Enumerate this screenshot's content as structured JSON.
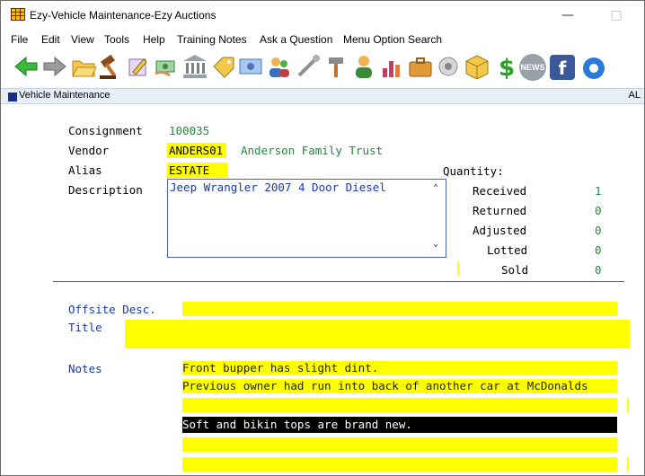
{
  "window": {
    "title": "Ezy-Vehicle Maintenance-Ezy Auctions",
    "minimize": "—",
    "maximize": "□"
  },
  "menu": [
    "File",
    "Edit",
    "View",
    "Tools",
    "Help",
    "Training Notes",
    "Ask a Question",
    "Menu Option Search"
  ],
  "toolbar": {
    "icons": [
      "back-arrow-icon",
      "forward-arrow-icon",
      "open-folder-icon",
      "auction-gavel-icon",
      "edit-icon",
      "money-hand-icon",
      "bank-icon",
      "tag-icon",
      "cash-icon",
      "users-icon",
      "wrench-icon",
      "hammer-icon",
      "person-icon",
      "chart-icon",
      "briefcase-icon",
      "settings-icon",
      "box-icon",
      "dollar-icon",
      "news-icon",
      "facebook-icon",
      "chrome-icon"
    ],
    "news_label": "NEWS",
    "facebook_label": "f"
  },
  "section": {
    "title": "Vehicle Maintenance",
    "right": "AL"
  },
  "form": {
    "consignment_label": "Consignment",
    "consignment_value": "100035",
    "vendor_label": "Vendor",
    "vendor_code": "ANDERS01",
    "vendor_name": "Anderson Family Trust",
    "alias_label": "Alias",
    "alias_value": "ESTATE",
    "description_label": "Description",
    "description_value": "Jeep Wrangler 2007 4 Door Diesel",
    "quantity_label": "Quantity:",
    "quantities": [
      {
        "label": "Received",
        "value": "1"
      },
      {
        "label": "Returned",
        "value": "0"
      },
      {
        "label": "Adjusted",
        "value": "0"
      },
      {
        "label": "Lotted",
        "value": "0"
      },
      {
        "label": "Sold",
        "value": "0"
      }
    ],
    "offsite_label": "Offsite Desc.",
    "offsite_value": "",
    "title_label": "Title",
    "title_value": "",
    "notes_label": "Notes",
    "notes": [
      "Front bupper has slight dint.",
      "Previous owner had run into back of another car at McDonalds",
      "",
      "Soft and bikin tops are brand new.",
      "",
      ""
    ]
  },
  "colors": {
    "label": "#000000",
    "value_green": "#1e8a3c",
    "link_blue": "#1a3aa8",
    "highlight": "#ffff00",
    "selected_row": "#000000"
  }
}
